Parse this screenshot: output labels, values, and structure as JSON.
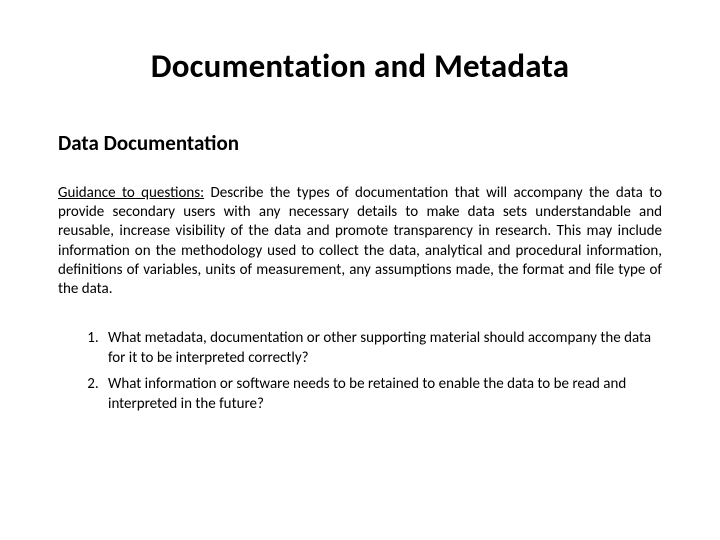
{
  "title": "Documentation and Metadata",
  "subhead": "Data Documentation",
  "guidance": {
    "lead": "Guidance to questions:",
    "body": " Describe the types of documentation that will accompany the data to provide secondary users with any necessary details to make data sets understandable and reusable, increase visibility of the data and promote transparency in research. This may include information on the methodology used to collect the data, analytical and procedural information, definitions of variables, units of measurement, any assumptions made, the format and file type of the data."
  },
  "questions": [
    "What metadata, documentation or other supporting material should accompany the data for it to be interpreted correctly?",
    "What information or software needs to be retained to enable the data to be read and interpreted in the future?"
  ]
}
